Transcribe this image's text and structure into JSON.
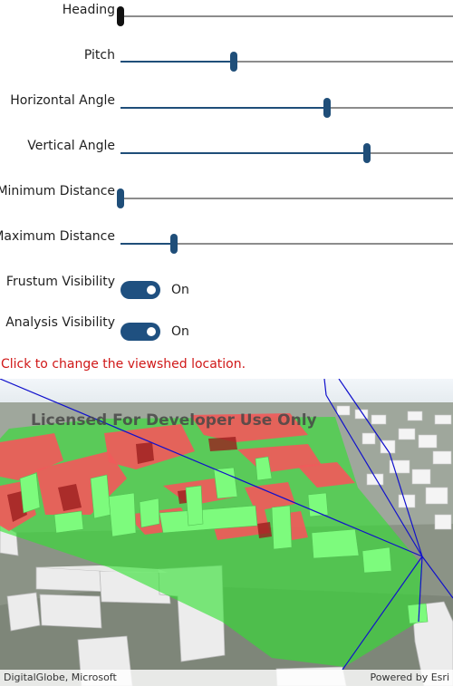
{
  "controls": {
    "sliders": [
      {
        "label": "Heading",
        "value": 0.0
      },
      {
        "label": "Pitch",
        "value": 0.34
      },
      {
        "label": "Horizontal Angle",
        "value": 0.62
      },
      {
        "label": "Vertical Angle",
        "value": 0.74
      },
      {
        "label": "Minimum Distance",
        "value": 0.0
      },
      {
        "label": "Maximum Distance",
        "value": 0.16
      }
    ],
    "toggles": [
      {
        "label": "Frustum Visibility",
        "state": "On"
      },
      {
        "label": "Analysis Visibility",
        "state": "On"
      }
    ]
  },
  "hint": "Click to change the viewshed location.",
  "map": {
    "watermark": "Licensed For Developer Use Only",
    "attribution_left": "DigitalGlobe, Microsoft",
    "attribution_right": "Powered by Esri"
  },
  "colors": {
    "accent": "#1f4e79",
    "hint": "#d01818",
    "visible": "#33dd33",
    "hidden": "#ee5555"
  }
}
